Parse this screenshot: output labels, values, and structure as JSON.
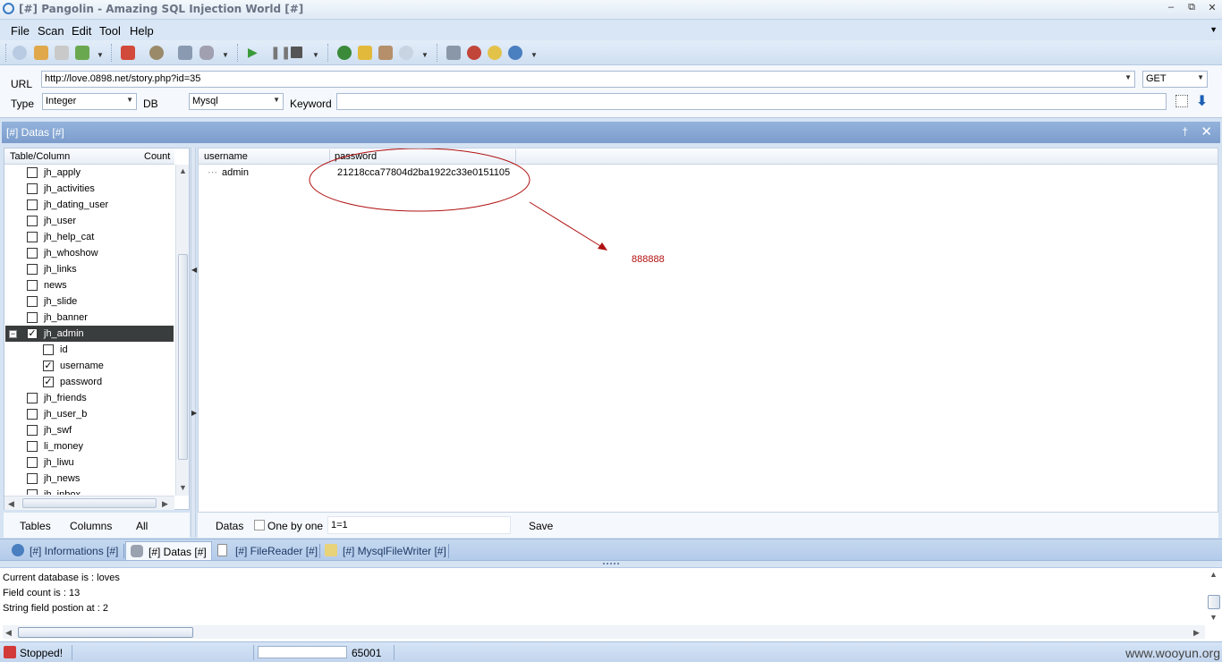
{
  "window": {
    "title": "[#] Pangolin - Amazing SQL Injection World [#]",
    "controls": {
      "minimize": "–",
      "restore": "⧉",
      "close": "✕"
    }
  },
  "menu": {
    "items": [
      "File",
      "Scan",
      "Edit",
      "Tool",
      "Help"
    ],
    "overflow_icon": "chevron-down-icon"
  },
  "toolbar": {
    "icons": [
      "search-icon",
      "open-icon",
      "save-icon",
      "export-icon",
      "config-icon",
      "plugin-icon",
      "wrench-icon",
      "database-icon",
      "play-icon",
      "pause-icon",
      "stop-icon",
      "check-icon",
      "key-icon",
      "users-icon",
      "find-icon",
      "home-icon",
      "bug-icon",
      "refresh-icon",
      "info-icon"
    ]
  },
  "request": {
    "url_label": "URL",
    "url_value": "http://love.0898.net/story.php?id=35",
    "method": "GET",
    "type_label": "Type",
    "type_value": "Integer",
    "db_label": "DB",
    "db_value": "Mysql",
    "keyword_label": "Keyword",
    "keyword_value": ""
  },
  "datas_panel": {
    "title": "[#] Datas [#]",
    "pin": "†",
    "close": "✕"
  },
  "tree": {
    "headers": [
      "Table/Column",
      "Count"
    ],
    "rows": [
      {
        "name": "jh_apply",
        "checked": false
      },
      {
        "name": "jh_activities",
        "checked": false
      },
      {
        "name": "jh_dating_user",
        "checked": false
      },
      {
        "name": "jh_user",
        "checked": false
      },
      {
        "name": "jh_help_cat",
        "checked": false
      },
      {
        "name": "jh_whoshow",
        "checked": false
      },
      {
        "name": "jh_links",
        "checked": false
      },
      {
        "name": "news",
        "checked": false
      },
      {
        "name": "jh_slide",
        "checked": false
      },
      {
        "name": "jh_banner",
        "checked": false
      },
      {
        "name": "jh_admin",
        "checked": true,
        "expanded": true,
        "selected": true
      },
      {
        "name": "id",
        "checked": false,
        "child": true
      },
      {
        "name": "username",
        "checked": true,
        "child": true
      },
      {
        "name": "password",
        "checked": true,
        "child": true
      },
      {
        "name": "jh_friends",
        "checked": false
      },
      {
        "name": "jh_user_b",
        "checked": false
      },
      {
        "name": "jh_swf",
        "checked": false
      },
      {
        "name": "li_money",
        "checked": false
      },
      {
        "name": "jh_liwu",
        "checked": false
      },
      {
        "name": "jh_news",
        "checked": false
      },
      {
        "name": "jh_inbox",
        "checked": false
      }
    ],
    "footer": [
      "Tables",
      "Columns",
      "All"
    ]
  },
  "grid": {
    "columns": [
      "username",
      "password"
    ],
    "rows": [
      {
        "username": "admin",
        "password": "21218cca77804d2ba1922c33e0151105"
      }
    ],
    "annotation": {
      "value": "888888",
      "color": "#b01010"
    }
  },
  "grid_footer": {
    "datas_label": "Datas",
    "one_by_one_label": "One by one",
    "one_by_one_checked": false,
    "condition_value": "1=1",
    "save_label": "Save"
  },
  "tabs": [
    {
      "label": "[#] Informations [#]",
      "icon": "info-icon",
      "active": false
    },
    {
      "label": "[#] Datas [#]",
      "icon": "database-icon",
      "active": true
    },
    {
      "label": "[#] FileReader [#]",
      "icon": "file-icon",
      "active": false
    },
    {
      "label": "[#] MysqlFileWriter [#]",
      "icon": "pencil-icon",
      "active": false
    }
  ],
  "log": {
    "lines": [
      "Current database is : loves",
      "Field count is : 13",
      "String field postion at : 2"
    ]
  },
  "status": {
    "text": "Stopped!",
    "count": "65001",
    "watermark": "www.wooyun.org"
  }
}
